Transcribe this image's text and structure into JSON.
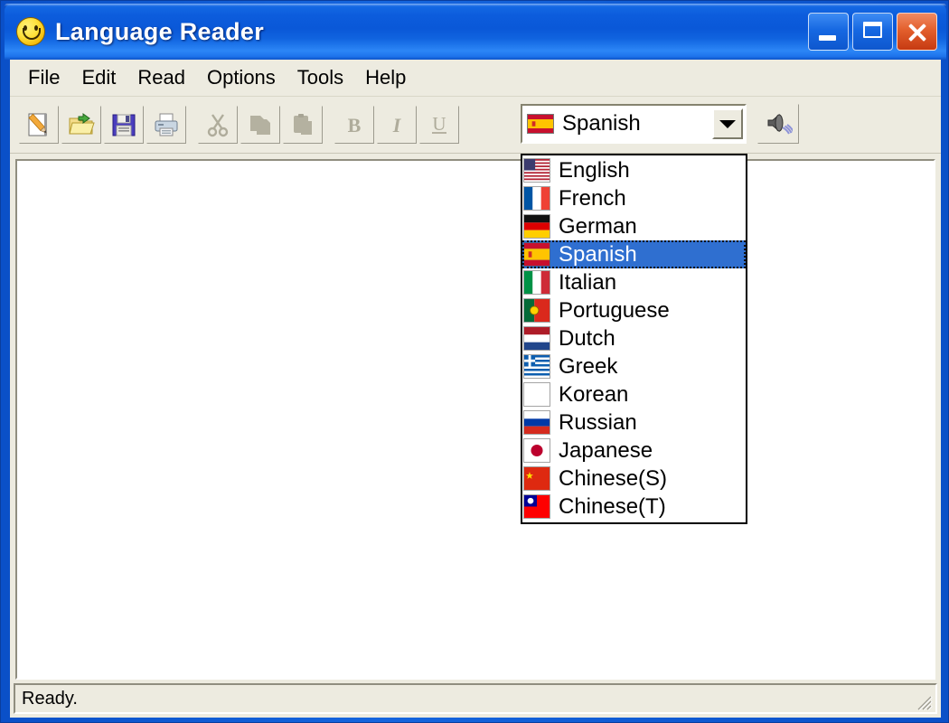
{
  "window": {
    "title": "Language Reader",
    "app_icon": "smiley-face-icon",
    "controls": {
      "minimize_label": "Minimize",
      "maximize_label": "Maximize",
      "close_label": "Close"
    },
    "accent_title_color": "#0A58D8",
    "frame_color": "#0A50C8",
    "client_bg": "#EDEBE0"
  },
  "menu": {
    "items": [
      {
        "label": "File"
      },
      {
        "label": "Edit"
      },
      {
        "label": "Read"
      },
      {
        "label": "Options"
      },
      {
        "label": "Tools"
      },
      {
        "label": "Help"
      }
    ]
  },
  "toolbar": {
    "buttons": [
      {
        "name": "new-document-button",
        "icon": "new-document-icon",
        "label": "New",
        "enabled": true
      },
      {
        "name": "open-file-button",
        "icon": "open-folder-icon",
        "label": "Open",
        "enabled": true
      },
      {
        "name": "save-file-button",
        "icon": "floppy-disk-icon",
        "label": "Save",
        "enabled": true
      },
      {
        "name": "print-button",
        "icon": "printer-icon",
        "label": "Print",
        "enabled": true
      },
      {
        "name": "cut-button",
        "icon": "scissors-icon",
        "label": "Cut",
        "enabled": false
      },
      {
        "name": "copy-button",
        "icon": "copy-pages-icon",
        "label": "Copy",
        "enabled": false
      },
      {
        "name": "paste-button",
        "icon": "clipboard-paste-icon",
        "label": "Paste",
        "enabled": false
      },
      {
        "name": "bold-button",
        "icon": "bold-icon",
        "label": "B",
        "enabled": false
      },
      {
        "name": "italic-button",
        "icon": "italic-icon",
        "label": "I",
        "enabled": false
      },
      {
        "name": "underline-button",
        "icon": "underline-icon",
        "label": "U",
        "enabled": false
      }
    ],
    "speak_button": {
      "name": "speak-button",
      "icon": "speaker-icon",
      "label": "Read Aloud"
    }
  },
  "language_combo": {
    "selected": "Spanish",
    "selected_index": 3,
    "expanded": true,
    "highlight_color": "#2F6FD0",
    "options": [
      {
        "label": "English",
        "flag": "flag-united-states"
      },
      {
        "label": "French",
        "flag": "flag-france"
      },
      {
        "label": "German",
        "flag": "flag-germany"
      },
      {
        "label": "Spanish",
        "flag": "flag-spain"
      },
      {
        "label": "Italian",
        "flag": "flag-italy"
      },
      {
        "label": "Portuguese",
        "flag": "flag-portugal"
      },
      {
        "label": "Dutch",
        "flag": "flag-netherlands"
      },
      {
        "label": "Greek",
        "flag": "flag-greece"
      },
      {
        "label": "Korean",
        "flag": "flag-south-korea"
      },
      {
        "label": "Russian",
        "flag": "flag-russia"
      },
      {
        "label": "Japanese",
        "flag": "flag-japan"
      },
      {
        "label": "Chinese(S)",
        "flag": "flag-china"
      },
      {
        "label": "Chinese(T)",
        "flag": "flag-taiwan"
      }
    ]
  },
  "editor": {
    "content": "",
    "placeholder": ""
  },
  "status_bar": {
    "text": "Ready."
  }
}
